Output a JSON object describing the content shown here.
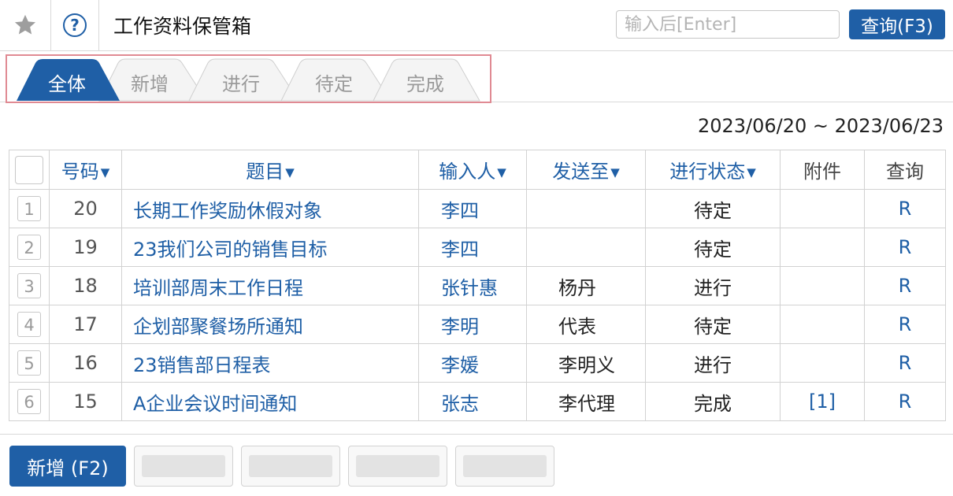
{
  "header": {
    "title": "工作资料保管箱",
    "search_placeholder": "输入后[Enter]",
    "search_button": "查询(F3)",
    "help_glyph": "?",
    "star_icon": "star-icon",
    "help_icon": "question-circle-icon"
  },
  "tabs": [
    {
      "label": "全体",
      "active": true
    },
    {
      "label": "新增",
      "active": false
    },
    {
      "label": "进行",
      "active": false
    },
    {
      "label": "待定",
      "active": false
    },
    {
      "label": "完成",
      "active": false
    }
  ],
  "date_range": "2023/06/20 ~ 2023/06/23",
  "table": {
    "headers": {
      "number": "号码",
      "subject": "题目",
      "author": "输入人",
      "recipient": "发送至",
      "status": "进行状态",
      "attachment": "附件",
      "query": "查询"
    },
    "sort_glyph": "▼",
    "rows": [
      {
        "index": "1",
        "number": "20",
        "subject": "长期工作奖励休假对象",
        "author": "李四",
        "recipient": "",
        "status": "待定",
        "attachment": "",
        "query": "R"
      },
      {
        "index": "2",
        "number": "19",
        "subject": "23我们公司的销售目标",
        "author": "李四",
        "recipient": "",
        "status": "待定",
        "attachment": "",
        "query": "R"
      },
      {
        "index": "3",
        "number": "18",
        "subject": "培训部周末工作日程",
        "author": "张针惠",
        "recipient": "杨丹",
        "status": "进行",
        "attachment": "",
        "query": "R"
      },
      {
        "index": "4",
        "number": "17",
        "subject": "企划部聚餐场所通知",
        "author": "李明",
        "recipient": "代表",
        "status": "待定",
        "attachment": "",
        "query": "R"
      },
      {
        "index": "5",
        "number": "16",
        "subject": "23销售部日程表",
        "author": "李媛",
        "recipient": "李明义",
        "status": "进行",
        "attachment": "",
        "query": "R"
      },
      {
        "index": "6",
        "number": "15",
        "subject": "A企业会议时间通知",
        "author": "张志",
        "recipient": "李代理",
        "status": "完成",
        "attachment": "[1]",
        "query": "R"
      }
    ]
  },
  "footer": {
    "add_button": "新增 (F2)"
  },
  "colors": {
    "accent": "#1f5fa6",
    "highlight_border": "#e08a93"
  }
}
